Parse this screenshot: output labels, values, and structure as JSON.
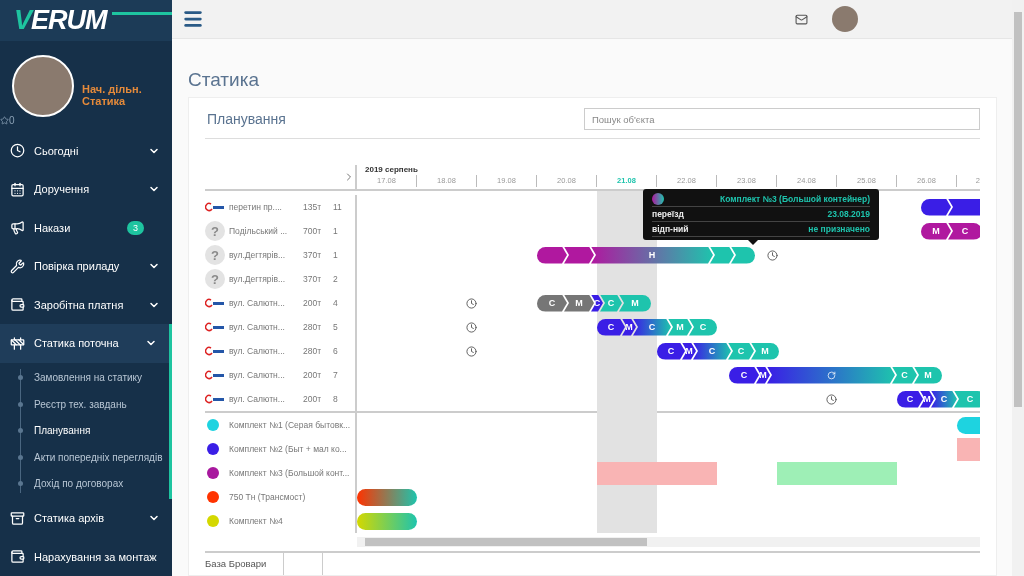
{
  "sidebar": {
    "logo": {
      "accent": "V",
      "rest": "ERUM"
    },
    "user": {
      "role": "Нач. дільн.",
      "department": "Статика",
      "rating": "0"
    },
    "items": [
      {
        "label": "Сьогодні",
        "chevron": true,
        "selected": false
      },
      {
        "label": "Доручення",
        "chevron": true,
        "selected": false
      },
      {
        "label": "Накази",
        "chevron": false,
        "badge": "3",
        "selected": false
      },
      {
        "label": "Повірка приладу",
        "chevron": true,
        "selected": false
      },
      {
        "label": "Заробітна платня",
        "chevron": true,
        "selected": false
      },
      {
        "label": "Статика поточна",
        "chevron": true,
        "selected": true,
        "expanded": true,
        "children": [
          {
            "label": "Замовлення на статику",
            "selected": false
          },
          {
            "label": "Реєстр тех. завдань",
            "selected": false
          },
          {
            "label": "Планування",
            "selected": true
          },
          {
            "label": "Акти попередніх переглядів",
            "selected": false
          },
          {
            "label": "Дохід по договорах",
            "selected": false
          }
        ]
      },
      {
        "label": "Статика архів",
        "chevron": true,
        "selected": false
      },
      {
        "label": "Нарахування за монтаж",
        "chevron": false,
        "selected": false
      }
    ]
  },
  "page": {
    "title": "Статика"
  },
  "card": {
    "title": "Планування",
    "search": {
      "placeholder": "Пошук об'єкта"
    }
  },
  "gantt": {
    "month": "2019 серпень",
    "days": [
      {
        "label": "17.08",
        "today": false
      },
      {
        "label": "18.08",
        "today": false
      },
      {
        "label": "19.08",
        "today": false
      },
      {
        "label": "20.08",
        "today": false
      },
      {
        "label": "21.08",
        "today": true
      },
      {
        "label": "22.08",
        "today": false
      },
      {
        "label": "23.08",
        "today": false
      },
      {
        "label": "24.08",
        "today": false
      },
      {
        "label": "25.08",
        "today": false
      },
      {
        "label": "26.08",
        "today": false
      },
      {
        "label": "2",
        "today": false
      }
    ],
    "rows": [
      {
        "kind": "company",
        "name": "перетин пр....",
        "weight": "135т",
        "count": "11",
        "track": [
          {
            "kind": "bar",
            "segments": [
              {
                "kind": "solid",
                "color": "#3a1ee6"
              },
              {
                "kind": "solid",
                "color": "#3a1ee6"
              }
            ]
          }
        ]
      },
      {
        "kind": "unknown",
        "avatar": "?",
        "name": "Подільський ...",
        "weight": "700т",
        "count": "1",
        "track": [
          {
            "kind": "bar",
            "segments": [
              {
                "kind": "solid",
                "label": "М",
                "color": "#b0189f"
              },
              {
                "kind": "solid",
                "label": "С",
                "color": "#b0189f"
              }
            ]
          }
        ]
      },
      {
        "kind": "unknown",
        "avatar": "?",
        "name": "вул.Дегтярів...",
        "weight": "370т",
        "count": "1",
        "track": [
          {
            "kind": "bar",
            "segments": [
              {
                "kind": "solid",
                "color": "#b0189f"
              },
              {
                "kind": "solid",
                "color": "#b0189f"
              },
              {
                "kind": "transition",
                "label": "Н"
              },
              {
                "kind": "solid",
                "color": "#1ec4ad"
              },
              {
                "kind": "solid",
                "color": "#1ec4ad"
              }
            ]
          },
          {
            "kind": "clock"
          }
        ]
      },
      {
        "kind": "unknown",
        "avatar": "?",
        "name": "вул.Дегтярів...",
        "weight": "370т",
        "count": "2"
      },
      {
        "kind": "company",
        "name": "вул. Салютн...",
        "weight": "200т",
        "count": "4",
        "track": [
          {
            "kind": "clock"
          },
          {
            "kind": "bar",
            "segments": [
              {
                "kind": "solid",
                "label": "С",
                "color": "#767676"
              },
              {
                "kind": "solid",
                "label": "М",
                "color": "#767676"
              },
              {
                "kind": "solid",
                "label": "С",
                "color": "#3a1ee6"
              },
              {
                "kind": "solid",
                "label": "С",
                "color": "#1ec4ad"
              },
              {
                "kind": "solid",
                "label": "М",
                "color": "#1ec4ad"
              }
            ]
          }
        ]
      },
      {
        "kind": "company",
        "name": "вул. Салютн...",
        "weight": "280т",
        "count": "5",
        "track": [
          {
            "kind": "clock"
          },
          {
            "kind": "bar",
            "segments": [
              {
                "kind": "solid",
                "label": "С",
                "color": "#3a1ee6"
              },
              {
                "kind": "solid",
                "label": "М",
                "color": "#3a1ee6"
              },
              {
                "kind": "transition",
                "label": "С"
              },
              {
                "kind": "solid",
                "label": "М",
                "color": "#1ec4ad"
              },
              {
                "kind": "solid",
                "label": "С",
                "color": "#1ec4ad"
              }
            ]
          }
        ]
      },
      {
        "kind": "company",
        "name": "вул. Салютн...",
        "weight": "280т",
        "count": "6",
        "track": [
          {
            "kind": "clock"
          },
          {
            "kind": "bar",
            "segments": [
              {
                "kind": "solid",
                "label": "С",
                "color": "#3a1ee6"
              },
              {
                "kind": "solid",
                "label": "М",
                "color": "#3a1ee6"
              },
              {
                "kind": "transition",
                "label": "С"
              },
              {
                "kind": "solid",
                "label": "С",
                "color": "#1ec4ad"
              },
              {
                "kind": "solid",
                "label": "М",
                "color": "#1ec4ad"
              }
            ]
          }
        ]
      },
      {
        "kind": "company",
        "name": "вул. Салютн...",
        "weight": "200т",
        "count": "7",
        "track": [
          {
            "kind": "bar",
            "segments": [
              {
                "kind": "solid",
                "label": "С",
                "color": "#3a1ee6"
              },
              {
                "kind": "solid",
                "label": "М",
                "color": "#3a1ee6"
              },
              {
                "kind": "pending"
              },
              {
                "kind": "solid",
                "label": "С",
                "color": "#1ec4ad"
              },
              {
                "kind": "solid",
                "label": "М",
                "color": "#1ec4ad"
              }
            ]
          }
        ]
      },
      {
        "kind": "company",
        "name": "вул. Салютн...",
        "weight": "200т",
        "count": "8",
        "track": [
          {
            "kind": "clock"
          },
          {
            "kind": "bar",
            "segments": [
              {
                "kind": "solid",
                "label": "С",
                "color": "#3a1ee6"
              },
              {
                "kind": "solid",
                "label": "М",
                "color": "#3a1ee6"
              },
              {
                "kind": "transition",
                "label": "С"
              },
              {
                "kind": "solid",
                "label": "С",
                "color": "#1ec4ad"
              }
            ]
          }
        ]
      }
    ],
    "resources": [
      {
        "color": "#1ed3e0",
        "name": "Комплект №1 (Серая бытовк...",
        "track": [
          {
            "kind": "bar",
            "segments": [
              {
                "kind": "solid",
                "color": "#1ed3e0"
              }
            ]
          }
        ]
      },
      {
        "color": "#3a1ee6",
        "name": "Комплект №2 (Быт + мал ко...",
        "track": [
          {
            "kind": "block",
            "color": "#f9b4b4"
          }
        ]
      },
      {
        "color": "#a8189e",
        "name": "Комплект №3 (Большой конт...",
        "track": [
          {
            "kind": "block",
            "color": "#f9b4b4"
          },
          {
            "kind": "block",
            "color": "#9eefb6"
          }
        ]
      },
      {
        "color": "#ff3300",
        "name": "750 Тн (Трансмост)",
        "track": [
          {
            "kind": "bar",
            "segments": [
              {
                "kind": "transition"
              }
            ]
          }
        ]
      },
      {
        "color": "#d4d800",
        "name": "Комплект №4",
        "track": [
          {
            "kind": "bar",
            "segments": [
              {
                "kind": "transition"
              }
            ]
          }
        ]
      }
    ],
    "tooltip": {
      "title": "Комплект №3 (Большой контейнер)",
      "rows": [
        {
          "label": "переїзд",
          "value": "23.08.2019"
        },
        {
          "label": "відп-ний",
          "value": "не призначено"
        }
      ]
    }
  },
  "bottom_tabs": [
    {
      "label": "База Бровари",
      "selected": true
    }
  ]
}
